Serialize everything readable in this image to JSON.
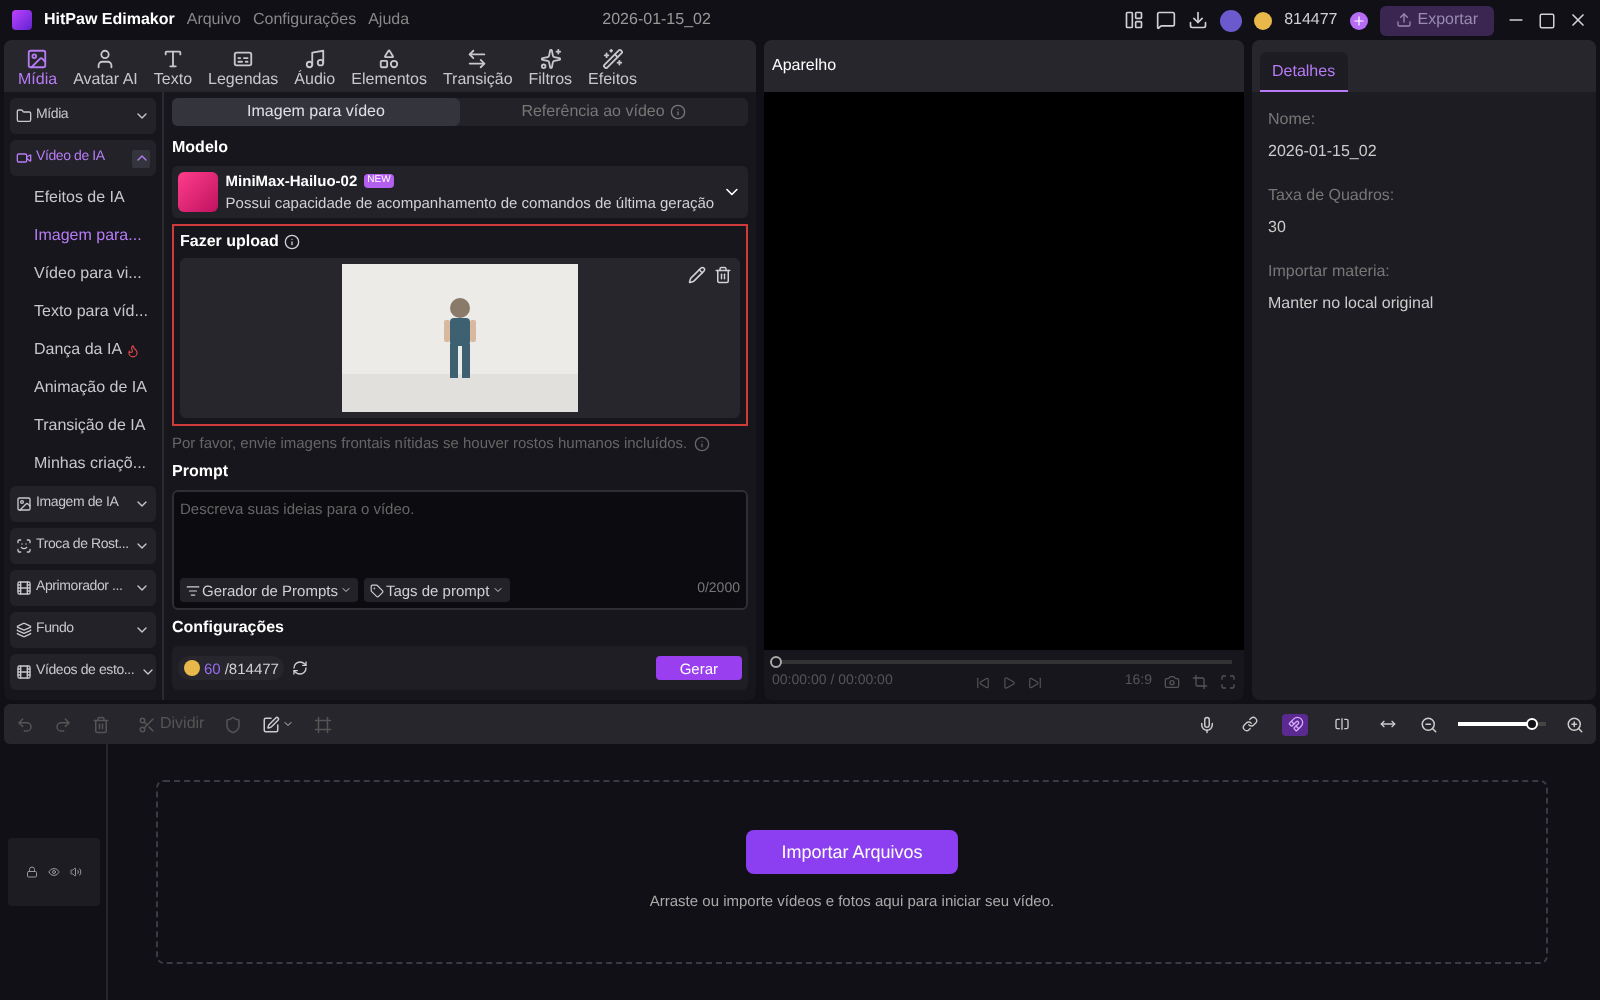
{
  "titlebar": {
    "app_name": "HitPaw Edimakor",
    "menu": [
      "Arquivo",
      "Configurações",
      "Ajuda"
    ],
    "project": "2026-01-15_02",
    "coins": "814477",
    "export": "Exportar"
  },
  "toolbar": [
    {
      "label": "Mídia",
      "selected": true
    },
    {
      "label": "Avatar AI",
      "selected": false
    },
    {
      "label": "Texto",
      "selected": false
    },
    {
      "label": "Legendas",
      "selected": false
    },
    {
      "label": "Áudio",
      "selected": false
    },
    {
      "label": "Elementos",
      "selected": false
    },
    {
      "label": "Transição",
      "selected": false
    },
    {
      "label": "Filtros",
      "selected": false
    },
    {
      "label": "Efeitos",
      "selected": false
    }
  ],
  "sidebar": [
    {
      "label": "Mídia",
      "expanded": false,
      "selected": false
    },
    {
      "label": "Vídeo de IA",
      "expanded": true,
      "selected": true,
      "children": [
        {
          "label": "Efeitos de IA",
          "selected": false
        },
        {
          "label": "Imagem para...",
          "selected": true
        },
        {
          "label": "Vídeo para vi...",
          "selected": false
        },
        {
          "label": "Texto para víd...",
          "selected": false
        },
        {
          "label": "Dança da IA",
          "selected": false
        },
        {
          "label": "Animação de IA",
          "selected": false
        },
        {
          "label": "Transição de IA",
          "selected": false
        },
        {
          "label": "Minhas criaçõ...",
          "selected": false
        }
      ]
    },
    {
      "label": "Imagem de IA",
      "expanded": false,
      "selected": false
    },
    {
      "label": "Troca de Rost...",
      "expanded": false,
      "selected": false
    },
    {
      "label": "Aprimorador ...",
      "expanded": false,
      "selected": false
    },
    {
      "label": "Fundo",
      "expanded": false,
      "selected": false
    },
    {
      "label": "Vídeos de esto...",
      "expanded": false,
      "selected": false
    }
  ],
  "mode_tabs": [
    {
      "label": "Imagem para vídeo",
      "selected": true
    },
    {
      "label": "Referência ao vídeo",
      "selected": false
    }
  ],
  "model": {
    "heading": "Modelo",
    "name": "MiniMax-Hailuo-02",
    "badge": "NEW",
    "description": "Possui capacidade de acompanhamento de comandos de última geração"
  },
  "upload": {
    "heading": "Fazer upload",
    "hint": "Por favor, envie imagens frontais nítidas se houver rostos humanos incluídos."
  },
  "prompt": {
    "heading": "Prompt",
    "placeholder": "Descreva suas ideias para o vídeo.",
    "buttons": [
      "Gerador de Prompts",
      "Tags de prompt"
    ],
    "counter": "0/2000"
  },
  "settings": {
    "heading": "Configurações",
    "cost": "60",
    "balance": "/814477",
    "generate": "Gerar"
  },
  "preview": {
    "title": "Aparelho",
    "time": "00:00:00 / 00:00:00",
    "ratio": "16:9",
    "level": 0
  },
  "details": {
    "tab": "Detalhes",
    "fields": [
      {
        "label": "Nome:",
        "value": "2026-01-15_02"
      },
      {
        "label": "Taxa de Quadros:",
        "value": "30"
      },
      {
        "label": "Importar materia:",
        "value": "Manter no local original"
      }
    ]
  },
  "timeline": {
    "split": "Dividir",
    "tools": [
      {
        "selected": false
      },
      {
        "selected": true
      },
      {
        "selected": false
      },
      {
        "selected": false
      }
    ],
    "zoom": {
      "level": 0.85
    },
    "import": "Importar Arquivos",
    "hint": "Arraste ou importe vídeos e fotos aqui para iniciar seu vídeo."
  }
}
